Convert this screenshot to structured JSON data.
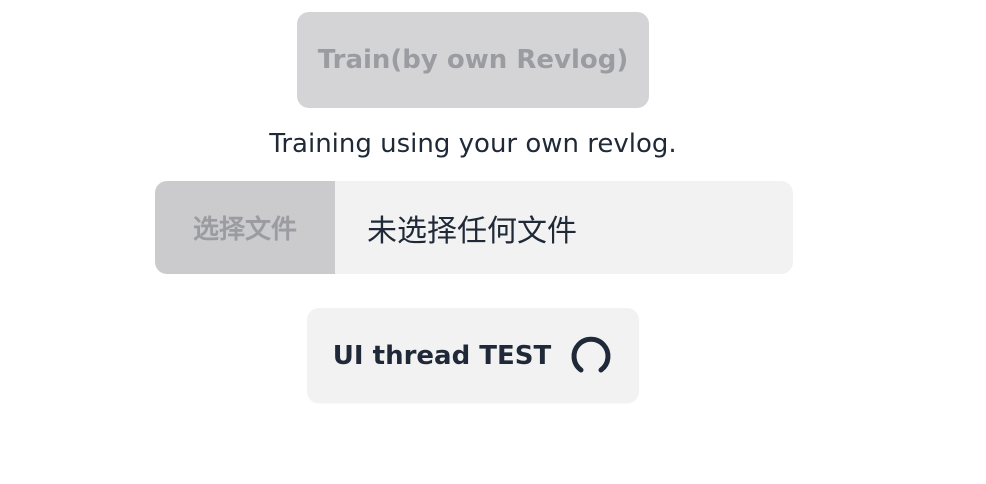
{
  "train_button": {
    "label": "Train(by own Revlog)",
    "disabled": true
  },
  "description": {
    "text": "Training using your own revlog."
  },
  "file_input": {
    "button_label": "选择文件",
    "status_text": "未选择任何文件"
  },
  "ui_test": {
    "label": "UI thread TEST",
    "icon": "spinner-icon"
  },
  "colors": {
    "text": "#1f2937",
    "disabled_text": "#9a9ca1",
    "disabled_button": "#d4d4d7",
    "file_button": "#cbcbcd",
    "light_surface": "#f2f2f2"
  }
}
